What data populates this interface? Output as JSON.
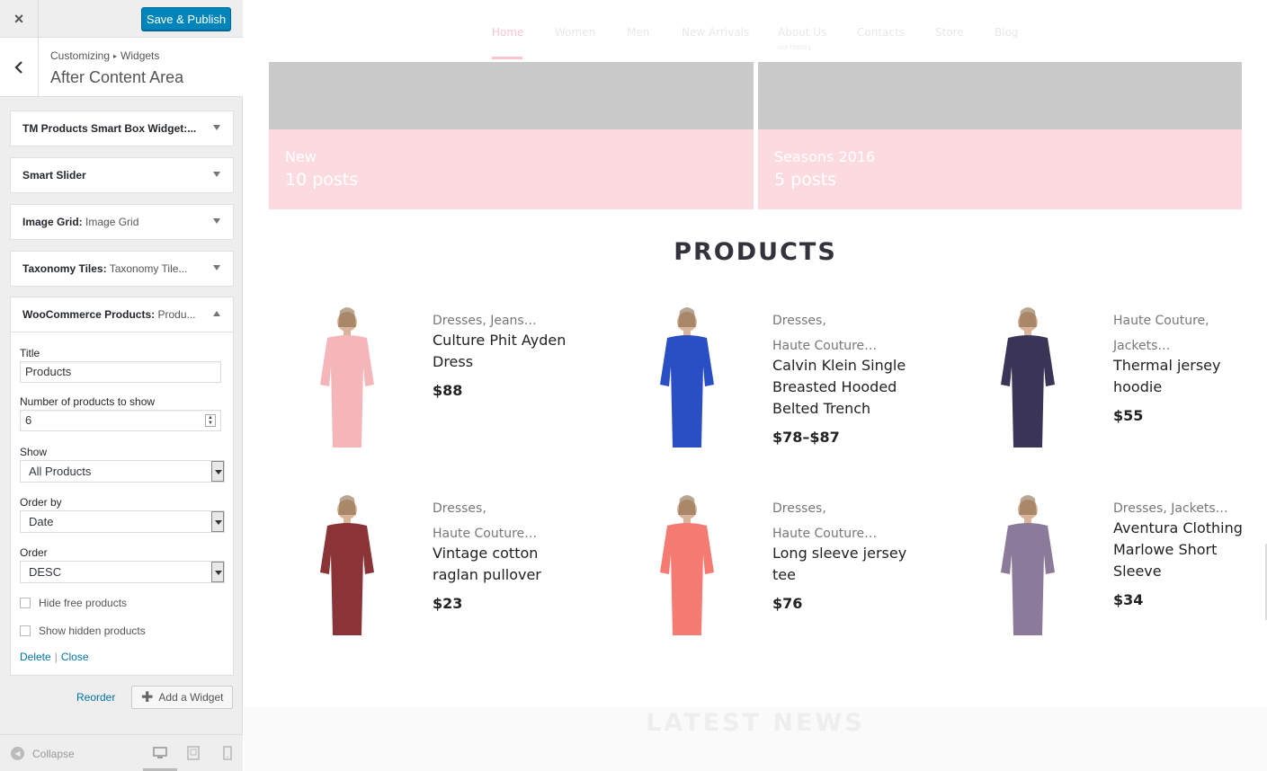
{
  "sidebar": {
    "close_icon": "×",
    "save_label": "Save & Publish",
    "back_icon": "‹",
    "breadcrumb": {
      "part1": "Customizing",
      "sep": "▸",
      "part2": "Widgets"
    },
    "section_title": "After Content Area",
    "widgets": [
      {
        "name": "TM Products Smart Box Widget:...",
        "sub": ""
      },
      {
        "name": "Smart Slider",
        "sub": ""
      },
      {
        "name": "Image Grid:",
        "sub": " Image Grid"
      },
      {
        "name": "Taxonomy Tiles:",
        "sub": " Taxonomy Tile..."
      },
      {
        "name": "WooCommerce Products:",
        "sub": " Produ..."
      }
    ],
    "form": {
      "title_label": "Title",
      "title_value": "Products",
      "number_label": "Number of products to show",
      "number_value": "6",
      "show_label": "Show",
      "show_value": "All Products",
      "orderby_label": "Order by",
      "orderby_value": "Date",
      "order_label": "Order",
      "order_value": "DESC",
      "hide_free": "Hide free products",
      "show_hidden": "Show hidden products",
      "delete": "Delete",
      "separator": "|",
      "close": "Close"
    },
    "reorder": "Reorder",
    "add_widget": "Add a Widget",
    "collapse": "Collapse"
  },
  "preview": {
    "nav": [
      "Home",
      "Women",
      "Men",
      "New Arrivals",
      "About Us",
      "Contacts",
      "Store",
      "Blog"
    ],
    "nav_sub": "our history",
    "tiles": [
      {
        "title": "New",
        "count": "10 posts"
      },
      {
        "title": "Seasons 2016",
        "count": "5 posts"
      }
    ],
    "products_heading": "PRODUCTS",
    "products": [
      {
        "cats": [
          "Dresses, Jeans…"
        ],
        "name": [
          "Culture Phit Ayden",
          "Dress"
        ],
        "price": "$88",
        "color": "#f4b6b8"
      },
      {
        "cats": [
          "Dresses,",
          "Haute Couture…"
        ],
        "name": [
          "Calvin Klein Single",
          "Breasted Hooded",
          "Belted Trench"
        ],
        "price": "$78–$87",
        "color": "#2a4fc4"
      },
      {
        "cats": [
          "Haute Couture,",
          "Jackets…"
        ],
        "name": [
          "Thermal jersey",
          "hoodie"
        ],
        "price": "$55",
        "color": "#3a3456"
      },
      {
        "cats": [
          "Dresses,",
          "Haute Couture…"
        ],
        "name": [
          "Vintage cotton",
          "raglan pullover"
        ],
        "price": "$23",
        "color": "#8a3437"
      },
      {
        "cats": [
          "Dresses,",
          "Haute Couture…"
        ],
        "name": [
          "Long sleeve jersey",
          "tee"
        ],
        "price": "$76",
        "color": "#f57a72"
      },
      {
        "cats": [
          "Dresses, Jackets…"
        ],
        "name": [
          "Aventura Clothing",
          "Marlowe Short",
          "Sleeve"
        ],
        "price": "$34",
        "color": "#8c7a9a"
      }
    ],
    "latest_heading": "LATEST NEWS"
  }
}
